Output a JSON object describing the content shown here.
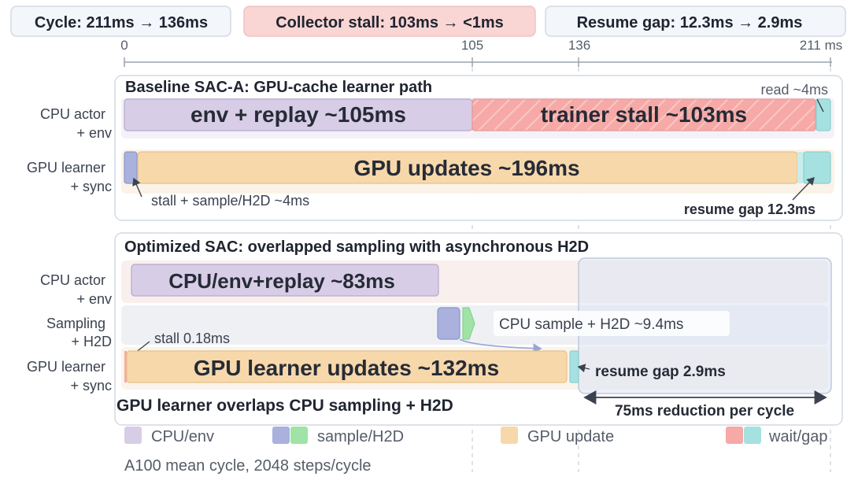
{
  "summary": {
    "cycle": "Cycle: 211ms → 136ms",
    "stall": "Collector stall: 103ms → <1ms",
    "resume": "Resume gap: 12.3ms → 2.9ms"
  },
  "axis": {
    "ticks": [
      "0",
      "105",
      "136",
      "211 ms"
    ]
  },
  "baseline": {
    "title": "Baseline SAC-A: GPU-cache learner path",
    "row_cpu": [
      "CPU actor",
      "+ env"
    ],
    "row_gpu": [
      "GPU learner",
      "+ sync"
    ],
    "env_replay": "env + replay ~105ms",
    "trainer_stall": "trainer stall ~103ms",
    "read": "read ~4ms",
    "gpu_updates": "GPU updates ~196ms",
    "stall_sample": "stall + sample/H2D ~4ms",
    "resume_gap": "resume gap 12.3ms"
  },
  "optimized": {
    "title": "Optimized SAC: overlapped sampling with asynchronous H2D",
    "row_cpu": [
      "CPU actor",
      "+ env"
    ],
    "row_sampling": [
      "Sampling",
      "+ H2D"
    ],
    "row_gpu": [
      "GPU learner",
      "+ sync"
    ],
    "cpu_env": "CPU/env+replay ~83ms",
    "cpu_sample": "CPU sample + H2D ~9.4ms",
    "stall": "stall 0.18ms",
    "gpu_updates": "GPU learner updates ~132ms",
    "resume_gap": "resume gap 2.9ms",
    "overlap_note": "GPU learner overlaps CPU sampling + H2D",
    "reduction": "75ms reduction per cycle"
  },
  "legend": {
    "cpu_env": "CPU/env",
    "sample_h2d": "sample/H2D",
    "gpu_update": "GPU update",
    "wait_gap": "wait/gap"
  },
  "footnote": "A100 mean cycle, 2048 steps/cycle",
  "colors": {
    "cpu": "#d8cde6",
    "sample": "#a9b1dc",
    "h2d": "#9fe3a6",
    "gpu": "#f7d8ab",
    "stall": "#f6a9a6",
    "gap": "#a6e1e1"
  }
}
